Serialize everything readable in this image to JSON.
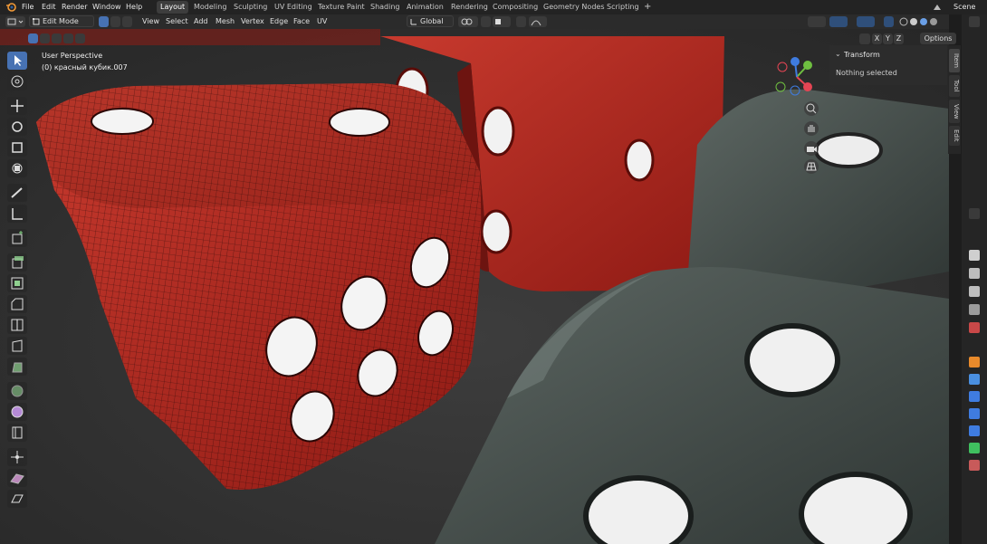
{
  "menubar": {
    "items": [
      "File",
      "Edit",
      "Render",
      "Window",
      "Help"
    ],
    "workspaces": [
      "Layout",
      "Modeling",
      "Sculpting",
      "UV Editing",
      "Texture Paint",
      "Shading",
      "Animation",
      "Rendering",
      "Compositing",
      "Geometry Nodes",
      "Scripting"
    ],
    "active_workspace": "Layout",
    "add_tab": "+",
    "scene_label": "Scene"
  },
  "header": {
    "mode": "Edit Mode",
    "menus": [
      "View",
      "Select",
      "Add",
      "Mesh",
      "Vertex",
      "Edge",
      "Face",
      "UV"
    ],
    "transform_orientation": "Global",
    "axis_labels": [
      "X",
      "Y",
      "Z"
    ],
    "options_label": "Options"
  },
  "viewport": {
    "perspective": "User Perspective",
    "object_name": "(0) красный кубик.007"
  },
  "npanel": {
    "section": "Transform",
    "status": "Nothing selected",
    "tabs": [
      "Item",
      "Tool",
      "View",
      "Edit"
    ]
  },
  "colors": {
    "accent": "#4772b3",
    "red_die": "#b3261e",
    "dark_die": "#4a5450",
    "gizmo_x": "#e54554",
    "gizmo_y": "#6fbf40",
    "gizmo_z": "#3f7ce0"
  },
  "icons": {
    "toolbar": [
      "select-box-icon",
      "cursor-icon",
      "move-icon",
      "rotate-icon",
      "scale-icon",
      "transform-icon",
      "annotate-icon",
      "measure-icon",
      "add-cube-icon",
      "extrude-icon",
      "inset-icon",
      "bevel-icon",
      "loop-cut-icon",
      "knife-icon",
      "poly-build-icon",
      "spin-icon",
      "smooth-icon",
      "edge-slide-icon",
      "shrink-fatten-icon",
      "shear-icon",
      "rip-icon"
    ]
  }
}
